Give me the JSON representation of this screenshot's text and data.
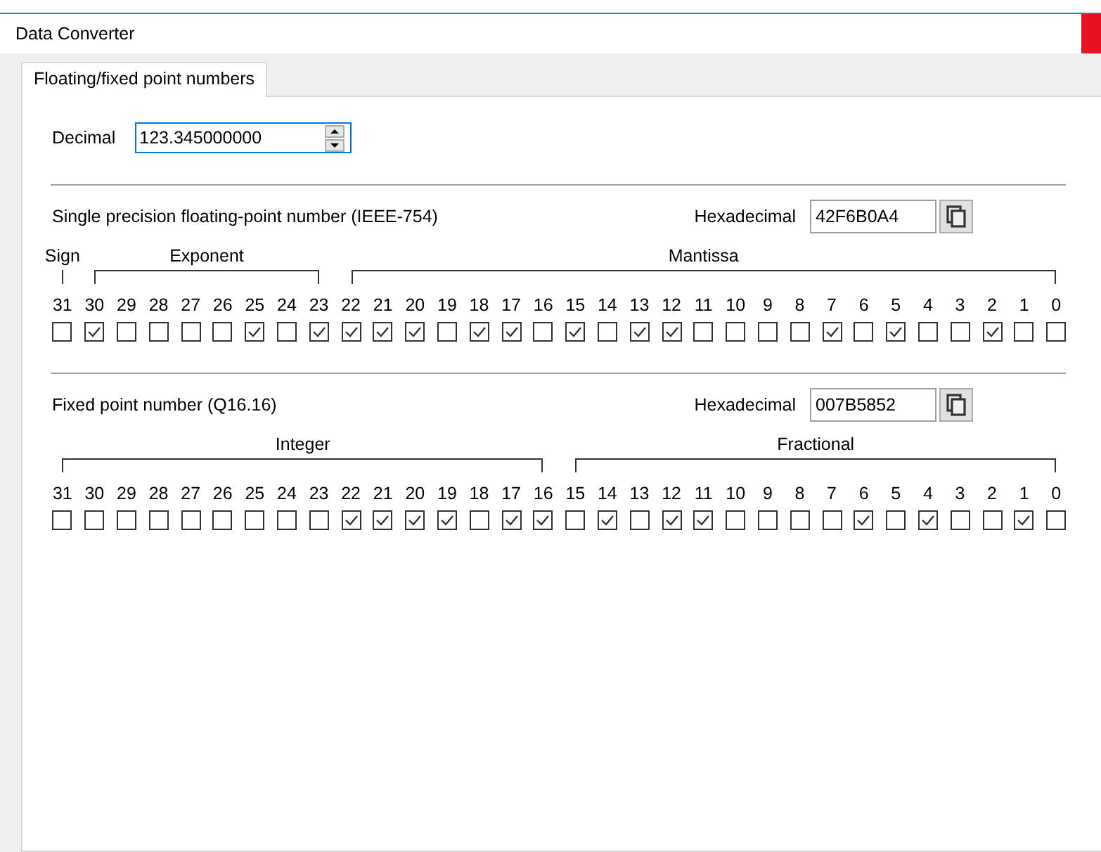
{
  "window": {
    "title": "Data Converter"
  },
  "tabs": [
    {
      "label": "Floating/fixed point numbers",
      "selected": true
    }
  ],
  "decimal": {
    "label": "Decimal",
    "value": "123.345000000"
  },
  "sections": [
    {
      "title": "Single precision floating-point number (IEEE-754)",
      "hex_label": "Hexadecimal",
      "hex_value": "42F6B0A4",
      "groups": [
        {
          "label": "Sign",
          "bits": [
            {
              "label": "31",
              "checked": false
            }
          ]
        },
        {
          "label": "Exponent",
          "bits": [
            {
              "label": "30",
              "checked": true
            },
            {
              "label": "29",
              "checked": false
            },
            {
              "label": "28",
              "checked": false
            },
            {
              "label": "27",
              "checked": false
            },
            {
              "label": "26",
              "checked": false
            },
            {
              "label": "25",
              "checked": true
            },
            {
              "label": "24",
              "checked": false
            },
            {
              "label": "23",
              "checked": true
            }
          ]
        },
        {
          "label": "Mantissa",
          "bits": [
            {
              "label": "22",
              "checked": true
            },
            {
              "label": "21",
              "checked": true
            },
            {
              "label": "20",
              "checked": true
            },
            {
              "label": "19",
              "checked": false
            },
            {
              "label": "18",
              "checked": true
            },
            {
              "label": "17",
              "checked": true
            },
            {
              "label": "16",
              "checked": false
            },
            {
              "label": "15",
              "checked": true
            },
            {
              "label": "14",
              "checked": false
            },
            {
              "label": "13",
              "checked": true
            },
            {
              "label": "12",
              "checked": true
            },
            {
              "label": "11",
              "checked": false
            },
            {
              "label": "10",
              "checked": false
            },
            {
              "label": "9",
              "checked": false
            },
            {
              "label": "8",
              "checked": false
            },
            {
              "label": "7",
              "checked": true
            },
            {
              "label": "6",
              "checked": false
            },
            {
              "label": "5",
              "checked": true
            },
            {
              "label": "4",
              "checked": false
            },
            {
              "label": "3",
              "checked": false
            },
            {
              "label": "2",
              "checked": true
            },
            {
              "label": "1",
              "checked": false
            },
            {
              "label": "0",
              "checked": false
            }
          ]
        }
      ]
    },
    {
      "title": "Fixed point number (Q16.16)",
      "hex_label": "Hexadecimal",
      "hex_value": "007B5852",
      "groups": [
        {
          "label": "Integer",
          "bits": [
            {
              "label": "31",
              "checked": false
            },
            {
              "label": "30",
              "checked": false
            },
            {
              "label": "29",
              "checked": false
            },
            {
              "label": "28",
              "checked": false
            },
            {
              "label": "27",
              "checked": false
            },
            {
              "label": "26",
              "checked": false
            },
            {
              "label": "25",
              "checked": false
            },
            {
              "label": "24",
              "checked": false
            },
            {
              "label": "23",
              "checked": false
            },
            {
              "label": "22",
              "checked": true
            },
            {
              "label": "21",
              "checked": true
            },
            {
              "label": "20",
              "checked": true
            },
            {
              "label": "19",
              "checked": true
            },
            {
              "label": "18",
              "checked": false
            },
            {
              "label": "17",
              "checked": true
            },
            {
              "label": "16",
              "checked": true
            }
          ]
        },
        {
          "label": "Fractional",
          "bits": [
            {
              "label": "15",
              "checked": false
            },
            {
              "label": "14",
              "checked": true
            },
            {
              "label": "13",
              "checked": false
            },
            {
              "label": "12",
              "checked": true
            },
            {
              "label": "11",
              "checked": true
            },
            {
              "label": "10",
              "checked": false
            },
            {
              "label": "9",
              "checked": false
            },
            {
              "label": "8",
              "checked": false
            },
            {
              "label": "7",
              "checked": false
            },
            {
              "label": "6",
              "checked": true
            },
            {
              "label": "5",
              "checked": false
            },
            {
              "label": "4",
              "checked": true
            },
            {
              "label": "3",
              "checked": false
            },
            {
              "label": "2",
              "checked": false
            },
            {
              "label": "1",
              "checked": true
            },
            {
              "label": "0",
              "checked": false
            }
          ]
        }
      ]
    }
  ]
}
